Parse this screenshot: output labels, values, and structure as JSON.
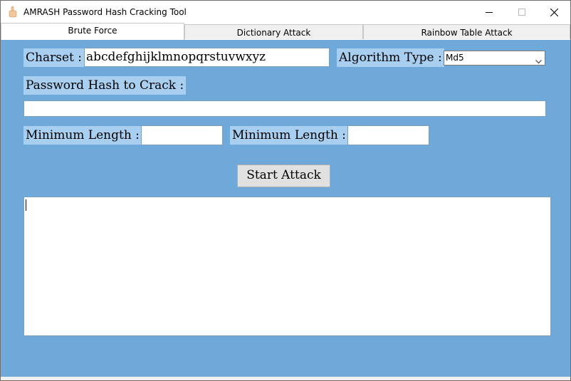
{
  "window": {
    "title": "AMRASH Password Hash Cracking Tool",
    "controls": [
      "minimize-icon",
      "maximize-icon",
      "close-icon"
    ]
  },
  "tabs": [
    {
      "label": "Brute Force",
      "active": true
    },
    {
      "label": "Dictionary Attack",
      "active": false
    },
    {
      "label": "Rainbow Table Attack",
      "active": false
    }
  ],
  "form": {
    "charset_label": "Charset :",
    "charset_value": "abcdefghijklmnopqrstuvwxyz",
    "algorithm_label": "Algorithm Type :",
    "algorithm_value": "Md5",
    "hash_label": "Password Hash to Crack :",
    "hash_value": "",
    "min_length_label": "Minimum Length :",
    "min_length_value": "",
    "min_length2_label": "Minimum Length :",
    "min_length2_value": "",
    "start_button": "Start Attack",
    "output_text": ""
  },
  "colors": {
    "background": "#6fa9d9",
    "label_background": "#a9cff0"
  }
}
